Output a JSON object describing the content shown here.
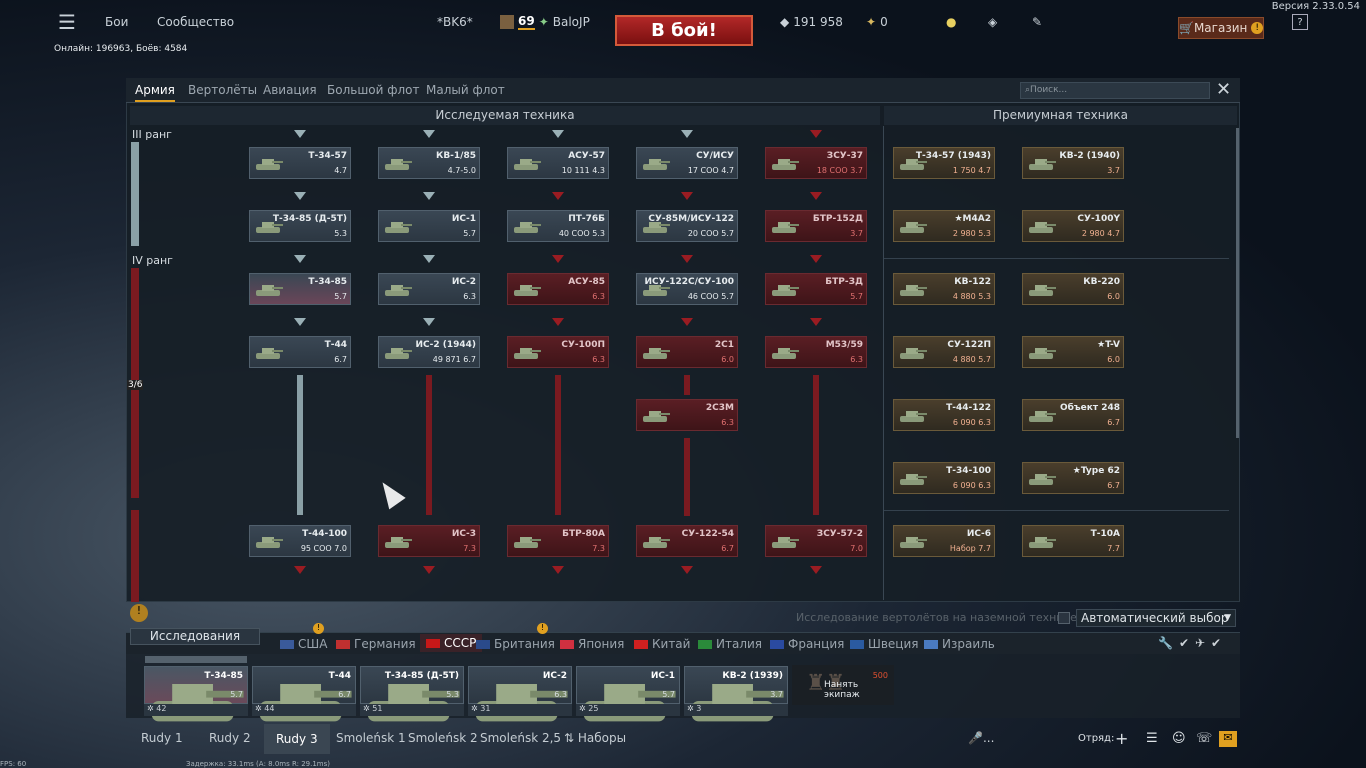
{
  "topbar": {
    "version": "Версия 2.33.0.54",
    "menu": "Бои",
    "community": "Сообщество",
    "vehicle": "*BK6*",
    "level": "69",
    "player": "BaloJP",
    "battle": "В бой!",
    "silver": "191 958",
    "gold": "0",
    "shop": "Магазин",
    "online": "Онлайн: 196963, Боёв: 4584"
  },
  "tabs": {
    "army": "Армия",
    "heli": "Вертолёты",
    "aviation": "Авиация",
    "bigfleet": "Большой флот",
    "smallfleet": "Малый флот",
    "search_placeholder": "Поиск..."
  },
  "sections": {
    "researched": "Исследуемая техника",
    "premium": "Премиумная техника"
  },
  "ranks": {
    "r3": "III ранг",
    "r4": "IV ранг",
    "progress": "3/6"
  },
  "tree": [
    {
      "name": "Т-34-57",
      "stat": "4.7"
    },
    {
      "name": "КВ-1/85",
      "stat": "4.7-5.0"
    },
    {
      "name": "АСУ-57",
      "stat": "10 111  4.3"
    },
    {
      "name": "СУ/ИСУ",
      "stat": "17 СОО  4.7"
    },
    {
      "name": "ЗСУ-37",
      "stat": "18 СОО  3.7"
    },
    {
      "name": "Т-34-85 (Д-5Т)",
      "stat": "5.3"
    },
    {
      "name": "ИС-1",
      "stat": "5.7"
    },
    {
      "name": "ПТ-76Б",
      "stat": "40 СОО  5.3"
    },
    {
      "name": "СУ-85М/ИСУ-122",
      "stat": "20 СОО  5.7"
    },
    {
      "name": "БТР-152Д",
      "stat": "3.7"
    },
    {
      "name": "Т-34-85",
      "stat": "5.7"
    },
    {
      "name": "ИС-2",
      "stat": "6.3"
    },
    {
      "name": "АСУ-85",
      "stat": "6.3"
    },
    {
      "name": "ИСУ-122С/СУ-100",
      "stat": "46 СОО  5.7"
    },
    {
      "name": "БТР-ЗД",
      "stat": "5.7"
    },
    {
      "name": "Т-44",
      "stat": "6.7"
    },
    {
      "name": "ИС-2 (1944)",
      "stat": "49 871  6.7"
    },
    {
      "name": "СУ-100П",
      "stat": "6.3"
    },
    {
      "name": "2С1",
      "stat": "6.0"
    },
    {
      "name": "М53/59",
      "stat": "6.3"
    },
    {
      "name": "2С3М",
      "stat": "6.3"
    },
    {
      "name": "Т-44-100",
      "stat": "95 СОО  7.0"
    },
    {
      "name": "ИС-3",
      "stat": "7.3"
    },
    {
      "name": "БТР-80А",
      "stat": "7.3"
    },
    {
      "name": "СУ-122-54",
      "stat": "6.7"
    },
    {
      "name": "ЗСУ-57-2",
      "stat": "7.0"
    }
  ],
  "premium": [
    {
      "name": "Т-34-57 (1943)",
      "stat": "1 750  4.7"
    },
    {
      "name": "КВ-2 (1940)",
      "stat": "3.7"
    },
    {
      "name": "★М4А2",
      "stat": "2 980  5.3"
    },
    {
      "name": "СУ-100Y",
      "stat": "2 980  4.7"
    },
    {
      "name": "КВ-122",
      "stat": "4 880  5.3"
    },
    {
      "name": "КВ-220",
      "stat": "6.0"
    },
    {
      "name": "СУ-122П",
      "stat": "4 880  5.7"
    },
    {
      "name": "★T-V",
      "stat": "6.0"
    },
    {
      "name": "Т-44-122",
      "stat": "6 090  6.3"
    },
    {
      "name": "Объект 248",
      "stat": "6.7"
    },
    {
      "name": "Т-34-100",
      "stat": "6 090  6.3"
    },
    {
      "name": "★Type 62",
      "stat": "6.7"
    },
    {
      "name": "ИС-6",
      "stat": "Набор 7.7"
    },
    {
      "name": "Т-10А",
      "stat": "7.7"
    }
  ],
  "lower": {
    "heli_research": "Исследование вертолётов на наземной технике",
    "auto": "Автоматический выбор",
    "research": "Исследования"
  },
  "nations": [
    "США",
    "Германия",
    "СССР",
    "Британия",
    "Япония",
    "Китай",
    "Италия",
    "Франция",
    "Швеция",
    "Израиль"
  ],
  "slots": [
    {
      "name": "Т-34-85",
      "br": "5.7",
      "crew": "42"
    },
    {
      "name": "Т-44",
      "br": "6.7",
      "crew": "44"
    },
    {
      "name": "Т-34-85 (Д-5Т)",
      "br": "5.3",
      "crew": "51"
    },
    {
      "name": "ИС-2",
      "br": "6.3",
      "crew": "31"
    },
    {
      "name": "ИС-1",
      "br": "5.7",
      "crew": "25"
    },
    {
      "name": "КВ-2 (1939)",
      "br": "3.7",
      "crew": "3"
    }
  ],
  "hire": {
    "label": "Нанять экипаж",
    "cost": "500"
  },
  "presets": [
    "Rudy 1",
    "Rudy 2",
    "Rudy 3",
    "Smoleńsk 1",
    "Smoleńsk 2",
    "Smoleńsk 2,5",
    "Наборы"
  ],
  "bottom": {
    "squad": "Отряд:",
    "mic": "...",
    "fps": "FPS: 60",
    "ping": "Задержка: 33.1ms (А: 8.0ms R: 29.1ms)"
  }
}
